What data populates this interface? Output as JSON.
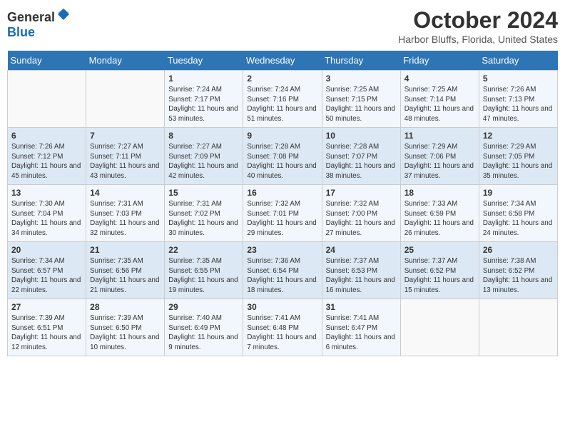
{
  "header": {
    "logo_general": "General",
    "logo_blue": "Blue",
    "month_title": "October 2024",
    "location": "Harbor Bluffs, Florida, United States"
  },
  "days_of_week": [
    "Sunday",
    "Monday",
    "Tuesday",
    "Wednesday",
    "Thursday",
    "Friday",
    "Saturday"
  ],
  "weeks": [
    [
      {
        "day": "",
        "info": ""
      },
      {
        "day": "",
        "info": ""
      },
      {
        "day": "1",
        "info": "Sunrise: 7:24 AM\nSunset: 7:17 PM\nDaylight: 11 hours and 53 minutes."
      },
      {
        "day": "2",
        "info": "Sunrise: 7:24 AM\nSunset: 7:16 PM\nDaylight: 11 hours and 51 minutes."
      },
      {
        "day": "3",
        "info": "Sunrise: 7:25 AM\nSunset: 7:15 PM\nDaylight: 11 hours and 50 minutes."
      },
      {
        "day": "4",
        "info": "Sunrise: 7:25 AM\nSunset: 7:14 PM\nDaylight: 11 hours and 48 minutes."
      },
      {
        "day": "5",
        "info": "Sunrise: 7:26 AM\nSunset: 7:13 PM\nDaylight: 11 hours and 47 minutes."
      }
    ],
    [
      {
        "day": "6",
        "info": "Sunrise: 7:26 AM\nSunset: 7:12 PM\nDaylight: 11 hours and 45 minutes."
      },
      {
        "day": "7",
        "info": "Sunrise: 7:27 AM\nSunset: 7:11 PM\nDaylight: 11 hours and 43 minutes."
      },
      {
        "day": "8",
        "info": "Sunrise: 7:27 AM\nSunset: 7:09 PM\nDaylight: 11 hours and 42 minutes."
      },
      {
        "day": "9",
        "info": "Sunrise: 7:28 AM\nSunset: 7:08 PM\nDaylight: 11 hours and 40 minutes."
      },
      {
        "day": "10",
        "info": "Sunrise: 7:28 AM\nSunset: 7:07 PM\nDaylight: 11 hours and 38 minutes."
      },
      {
        "day": "11",
        "info": "Sunrise: 7:29 AM\nSunset: 7:06 PM\nDaylight: 11 hours and 37 minutes."
      },
      {
        "day": "12",
        "info": "Sunrise: 7:29 AM\nSunset: 7:05 PM\nDaylight: 11 hours and 35 minutes."
      }
    ],
    [
      {
        "day": "13",
        "info": "Sunrise: 7:30 AM\nSunset: 7:04 PM\nDaylight: 11 hours and 34 minutes."
      },
      {
        "day": "14",
        "info": "Sunrise: 7:31 AM\nSunset: 7:03 PM\nDaylight: 11 hours and 32 minutes."
      },
      {
        "day": "15",
        "info": "Sunrise: 7:31 AM\nSunset: 7:02 PM\nDaylight: 11 hours and 30 minutes."
      },
      {
        "day": "16",
        "info": "Sunrise: 7:32 AM\nSunset: 7:01 PM\nDaylight: 11 hours and 29 minutes."
      },
      {
        "day": "17",
        "info": "Sunrise: 7:32 AM\nSunset: 7:00 PM\nDaylight: 11 hours and 27 minutes."
      },
      {
        "day": "18",
        "info": "Sunrise: 7:33 AM\nSunset: 6:59 PM\nDaylight: 11 hours and 26 minutes."
      },
      {
        "day": "19",
        "info": "Sunrise: 7:34 AM\nSunset: 6:58 PM\nDaylight: 11 hours and 24 minutes."
      }
    ],
    [
      {
        "day": "20",
        "info": "Sunrise: 7:34 AM\nSunset: 6:57 PM\nDaylight: 11 hours and 22 minutes."
      },
      {
        "day": "21",
        "info": "Sunrise: 7:35 AM\nSunset: 6:56 PM\nDaylight: 11 hours and 21 minutes."
      },
      {
        "day": "22",
        "info": "Sunrise: 7:35 AM\nSunset: 6:55 PM\nDaylight: 11 hours and 19 minutes."
      },
      {
        "day": "23",
        "info": "Sunrise: 7:36 AM\nSunset: 6:54 PM\nDaylight: 11 hours and 18 minutes."
      },
      {
        "day": "24",
        "info": "Sunrise: 7:37 AM\nSunset: 6:53 PM\nDaylight: 11 hours and 16 minutes."
      },
      {
        "day": "25",
        "info": "Sunrise: 7:37 AM\nSunset: 6:52 PM\nDaylight: 11 hours and 15 minutes."
      },
      {
        "day": "26",
        "info": "Sunrise: 7:38 AM\nSunset: 6:52 PM\nDaylight: 11 hours and 13 minutes."
      }
    ],
    [
      {
        "day": "27",
        "info": "Sunrise: 7:39 AM\nSunset: 6:51 PM\nDaylight: 11 hours and 12 minutes."
      },
      {
        "day": "28",
        "info": "Sunrise: 7:39 AM\nSunset: 6:50 PM\nDaylight: 11 hours and 10 minutes."
      },
      {
        "day": "29",
        "info": "Sunrise: 7:40 AM\nSunset: 6:49 PM\nDaylight: 11 hours and 9 minutes."
      },
      {
        "day": "30",
        "info": "Sunrise: 7:41 AM\nSunset: 6:48 PM\nDaylight: 11 hours and 7 minutes."
      },
      {
        "day": "31",
        "info": "Sunrise: 7:41 AM\nSunset: 6:47 PM\nDaylight: 11 hours and 6 minutes."
      },
      {
        "day": "",
        "info": ""
      },
      {
        "day": "",
        "info": ""
      }
    ]
  ]
}
